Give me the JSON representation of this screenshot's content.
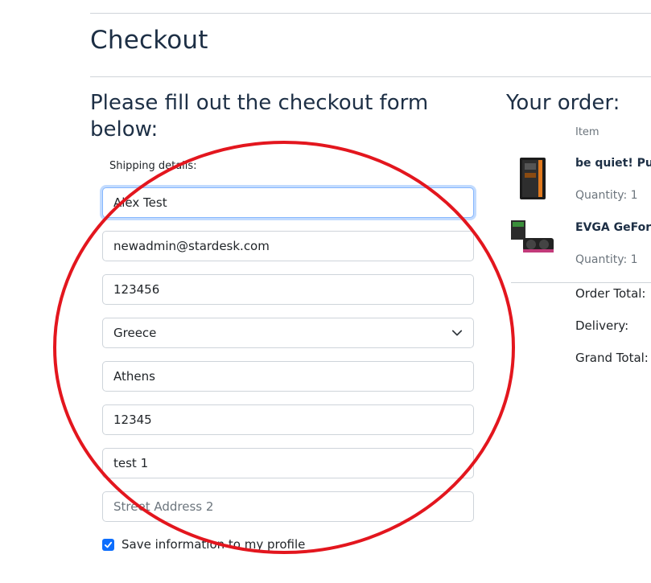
{
  "page": {
    "title": "Checkout"
  },
  "form": {
    "heading": "Please fill out the checkout form below:",
    "shipping_label": "Shipping details:",
    "fields": {
      "name": {
        "value": "Alex Test"
      },
      "email": {
        "value": "newadmin@stardesk.com"
      },
      "phone": {
        "value": "123456"
      },
      "country": {
        "value": "Greece"
      },
      "city": {
        "value": "Athens"
      },
      "postal_code": {
        "value": "12345"
      },
      "street1": {
        "value": "test 1"
      },
      "street2": {
        "value": "",
        "placeholder": "Street Address 2"
      }
    },
    "save_checkbox": {
      "checked": true,
      "label": "Save information to my profile"
    }
  },
  "order": {
    "heading": "Your order:",
    "column_item": "Item",
    "items": [
      {
        "name": "be quiet! Pur",
        "quantity": "Quantity: 1",
        "icon": "pc-case-image"
      },
      {
        "name": "EVGA GeForc",
        "quantity": "Quantity: 1",
        "icon": "graphics-card-image"
      }
    ],
    "totals": {
      "order_total": "Order Total:",
      "delivery": "Delivery:",
      "grand_total": "Grand Total:"
    }
  },
  "colors": {
    "heading": "#1d2f45",
    "accent": "#0d6efd",
    "annotation": "#e3161e"
  }
}
